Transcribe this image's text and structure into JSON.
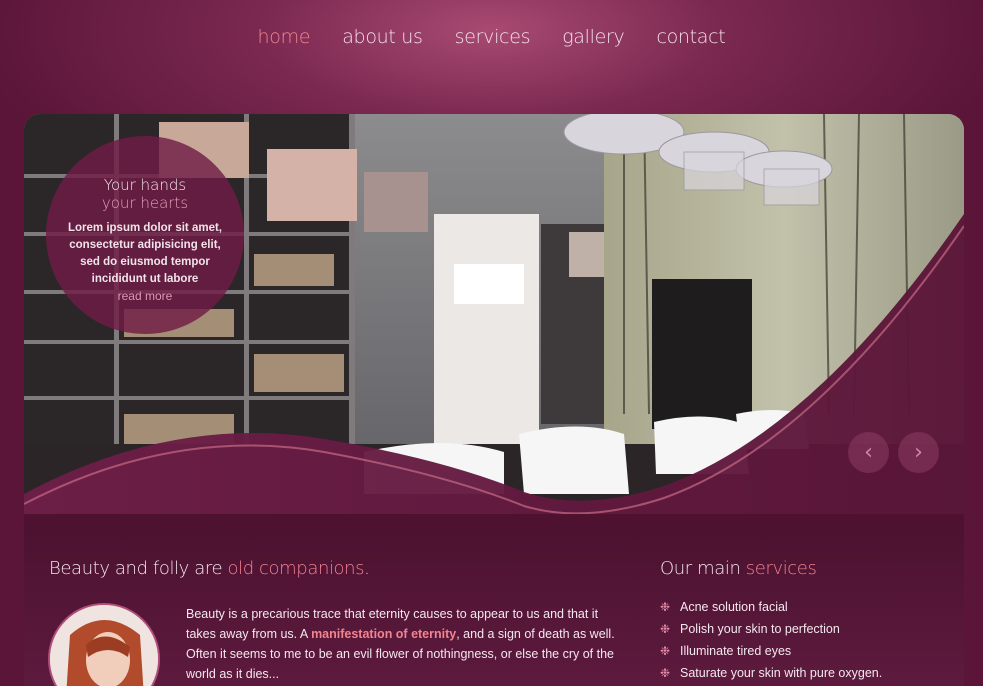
{
  "nav": {
    "items": [
      {
        "label": "home",
        "active": true
      },
      {
        "label": "about us",
        "active": false
      },
      {
        "label": "services",
        "active": false
      },
      {
        "label": "gallery",
        "active": false
      },
      {
        "label": "contact",
        "active": false
      }
    ]
  },
  "slider": {
    "title_line1": "Your hands",
    "title_line2": "your hearts",
    "text": "Lorem ipsum dolor sit amet, consectetur adipisicing elit, sed do eiusmod tempor incididunt ut labore",
    "read_more": "read more",
    "prev_icon": "‹",
    "next_icon": "›"
  },
  "about": {
    "heading_plain": "Beauty and folly are ",
    "heading_accent": "old companions",
    "heading_end": ".",
    "text_before": "Beauty is a precarious trace that eternity causes to appear to us and that it takes away from us. A ",
    "text_link": "manifestation of eternity",
    "text_after": ", and a sign of death as well. Often it seems to me to be an evil flower of nothingness, or else the cry of the world as it dies..."
  },
  "services": {
    "heading_plain": "Our main ",
    "heading_accent": "services",
    "bullet_icon": "❉",
    "items": [
      "Acne solution facial",
      "Polish your skin to perfection",
      "Illuminate tired eyes",
      "Saturate your skin with pure oxygen."
    ]
  },
  "colors": {
    "background": "#5a1538",
    "accent": "#f2848f",
    "text": "#f4e8ee"
  }
}
